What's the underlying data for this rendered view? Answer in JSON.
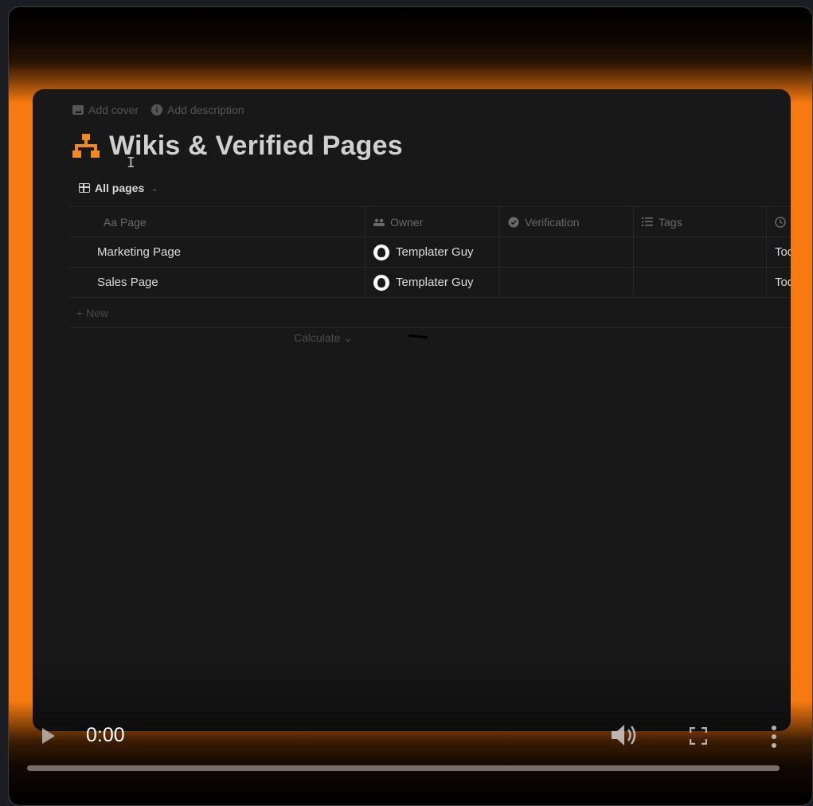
{
  "page": {
    "actions": {
      "add_cover": "Add cover",
      "add_description": "Add description"
    },
    "title": "Wikis & Verified Pages",
    "view_tab": "All pages"
  },
  "table": {
    "headers": {
      "page": "Aa Page",
      "owner": "Owner",
      "verification": "Verification",
      "tags": "Tags"
    },
    "rows": [
      {
        "page": "Marketing Page",
        "owner": "Templater Guy",
        "last": "Tod"
      },
      {
        "page": "Sales Page",
        "owner": "Templater Guy",
        "last": "Tod"
      }
    ],
    "new_label": "+ New",
    "calculate_label": "Calculate ⌄"
  },
  "player": {
    "time": "0:00",
    "progress": 0
  },
  "colors": {
    "accent": "#f57a10",
    "icon_orange": "#f08a1e"
  },
  "icons": [
    "image-icon",
    "info-icon",
    "sitemap-icon",
    "table-icon",
    "people-icon",
    "verified-icon",
    "list-icon",
    "clock-icon",
    "play-icon",
    "volume-icon",
    "fullscreen-icon",
    "more-vert-icon"
  ]
}
